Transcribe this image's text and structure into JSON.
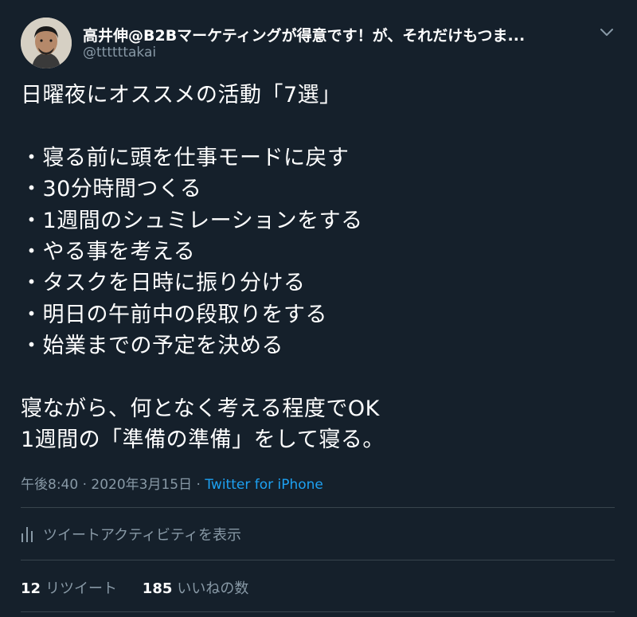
{
  "tweet": {
    "display_name": "高井伸@B2Bマーケティングが得意です！が、それだけもつま...",
    "handle": "@ttttttakai",
    "body": "日曜夜にオススメの活動「7選」\n\n・寝る前に頭を仕事モードに戻す\n・30分時間つくる\n・1週間のシュミレーションをする\n・やる事を考える\n・タスクを日時に振り分ける\n・明日の午前中の段取りをする\n・始業までの予定を決める\n\n寝ながら、何となく考える程度でOK\n1週間の「準備の準備」をして寝る。",
    "time": "午後8:40",
    "separator": "·",
    "date": "2020年3月15日",
    "source": "Twitter for iPhone"
  },
  "activity_label": "ツイートアクティビティを表示",
  "stats": {
    "retweets_count": "12",
    "retweets_label": "リツイート",
    "likes_count": "185",
    "likes_label": "いいねの数"
  },
  "colors": {
    "background": "#15202b",
    "text": "#ffffff",
    "muted": "#8899a6",
    "link": "#1da1f2",
    "divider": "#38444d"
  },
  "icons": {
    "caret": "chevron-down-icon",
    "activity": "bar-chart-icon"
  }
}
